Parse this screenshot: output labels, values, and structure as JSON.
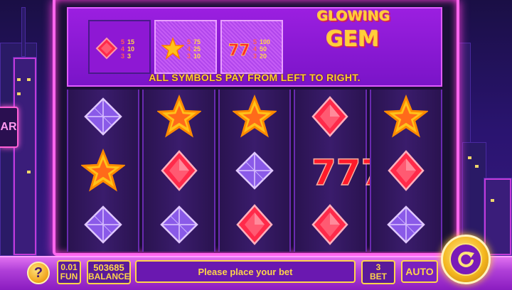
{
  "paytable": {
    "gem": {
      "lines": [
        {
          "count": "5",
          "pay": "15"
        },
        {
          "count": "4",
          "pay": "10"
        },
        {
          "count": "3",
          "pay": "3"
        }
      ]
    },
    "star": {
      "lines": [
        {
          "count": "5",
          "pay": "75"
        },
        {
          "count": "4",
          "pay": "25"
        },
        {
          "count": "3",
          "pay": "10"
        }
      ]
    },
    "seven": {
      "lines": [
        {
          "count": "5",
          "pay": "100"
        },
        {
          "count": "4",
          "pay": "50"
        },
        {
          "count": "3",
          "pay": "20"
        }
      ]
    }
  },
  "logo": {
    "line1": "GLOWING",
    "line2": "GEM"
  },
  "pay_note": "ALL SYMBOLS PAY FROM LEFT TO RIGHT.",
  "background": {
    "sign_text": "AR"
  },
  "reels": [
    [
      "crystal-icon",
      "star-icon",
      "crystal-icon"
    ],
    [
      "star-icon",
      "ruby-icon",
      "crystal-icon"
    ],
    [
      "star-icon",
      "crystal-icon",
      "ruby-icon"
    ],
    [
      "ruby-icon",
      "seven-icon",
      "ruby-icon"
    ],
    [
      "star-icon",
      "ruby-icon",
      "crystal-icon"
    ]
  ],
  "bottom_bar": {
    "help_label": "?",
    "fun_value": "0.01",
    "fun_label": "FUN",
    "balance_value": "503685",
    "balance_label": "BALANCE",
    "message": "Please place your bet",
    "bet_value": "3",
    "bet_label": "BET",
    "auto_label": "AUTO"
  },
  "colors": {
    "frame": "#ff66ee",
    "gold": "#ffd54a",
    "panel": "#8e18d4",
    "ruby": "#ff2a4a",
    "crystal": "#b07aff",
    "star": "#ffc21a"
  }
}
